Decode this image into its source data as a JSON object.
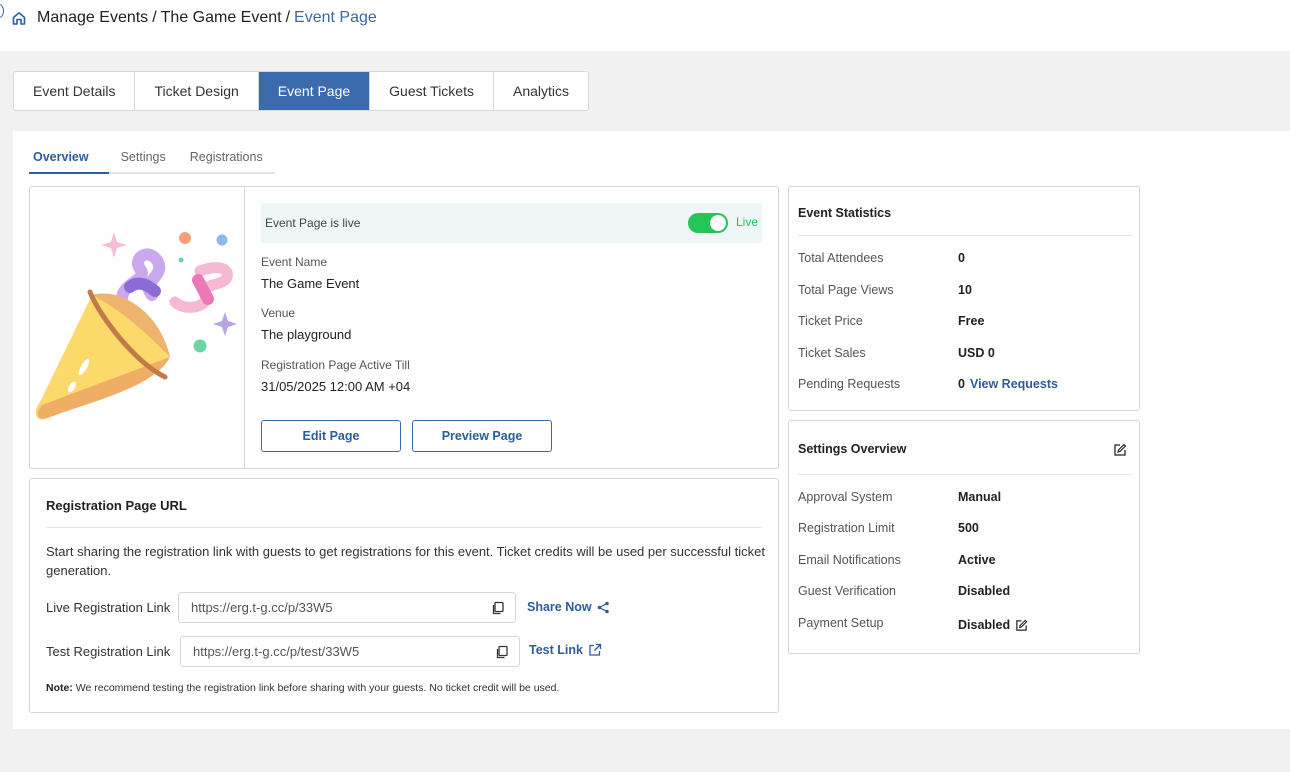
{
  "breadcrumb": {
    "items": [
      "Manage Events",
      "The Game Event"
    ],
    "current": "Event Page",
    "separator": "/"
  },
  "tabs": [
    "Event Details",
    "Ticket Design",
    "Event Page",
    "Guest Tickets",
    "Analytics"
  ],
  "active_tab": "Event Page",
  "subtabs": [
    "Overview",
    "Settings",
    "Registrations"
  ],
  "active_subtab": "Overview",
  "event_card": {
    "status_text": "Event Page is live",
    "toggle_label": "Live",
    "toggle_on": true,
    "event_name_label": "Event Name",
    "event_name": "The Game Event",
    "venue_label": "Venue",
    "venue": "The playground",
    "active_till_label": "Registration Page Active Till",
    "active_till": "31/05/2025 12:00 AM +04",
    "edit_button": "Edit Page",
    "preview_button": "Preview Page",
    "illustration": "party-popper-icon"
  },
  "registration": {
    "title": "Registration Page URL",
    "description": "Start sharing the registration link with guests to get registrations for this event. Ticket credits will be used per successful ticket generation.",
    "live_label": "Live Registration Link",
    "live_url": "https://erg.t-g.cc/p/33W5",
    "share_label": "Share Now",
    "test_label": "Test Registration Link",
    "test_url": "https://erg.t-g.cc/p/test/33W5",
    "test_link_label": "Test Link",
    "note_prefix": "Note:",
    "note_text": " We recommend testing the registration link before sharing with your guests. No ticket credit will be used."
  },
  "statistics": {
    "title": "Event Statistics",
    "rows": [
      {
        "label": "Total Attendees",
        "value": "0"
      },
      {
        "label": "Total Page Views",
        "value": "10"
      },
      {
        "label": "Ticket Price",
        "value": "Free"
      },
      {
        "label": "Ticket Sales",
        "value": "USD 0"
      },
      {
        "label": "Pending Requests",
        "value": "0",
        "link": "View Requests"
      }
    ]
  },
  "settings_overview": {
    "title": "Settings Overview",
    "rows": [
      {
        "label": "Approval System",
        "value": "Manual"
      },
      {
        "label": "Registration Limit",
        "value": "500"
      },
      {
        "label": "Email Notifications",
        "value": "Active"
      },
      {
        "label": "Guest Verification",
        "value": "Disabled"
      },
      {
        "label": "Payment Setup",
        "value": "Disabled"
      }
    ]
  },
  "colors": {
    "accent": "#3b6bad",
    "live_green": "#27c45a",
    "link_blue": "#2d5d9b"
  }
}
